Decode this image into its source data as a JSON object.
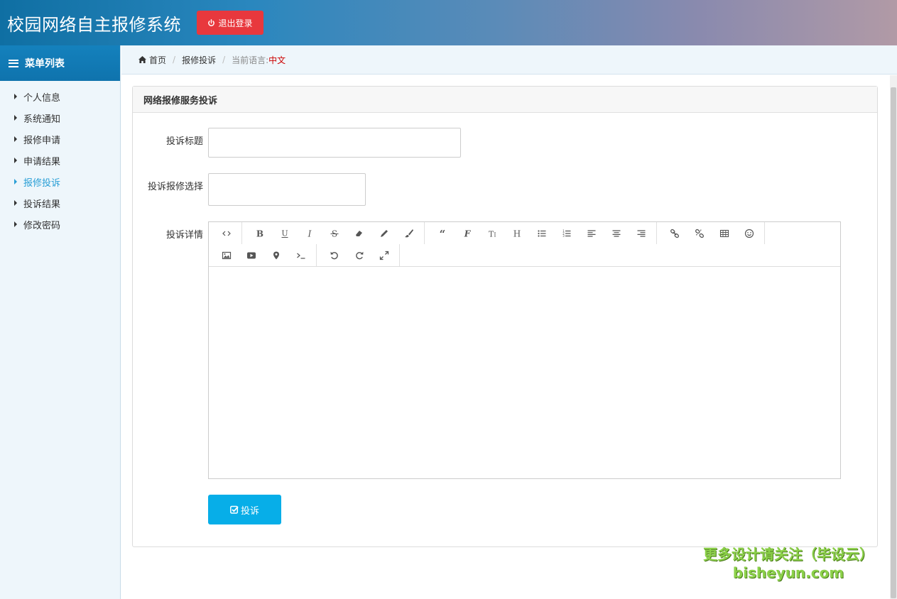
{
  "header": {
    "title": "校园网络自主报修系统",
    "logout_label": "退出登录",
    "logout_color": "#e8383d"
  },
  "sidebar": {
    "heading": "菜单列表",
    "items": [
      {
        "label": "个人信息",
        "active": false
      },
      {
        "label": "系统通知",
        "active": false
      },
      {
        "label": "报修申请",
        "active": false
      },
      {
        "label": "申请结果",
        "active": false
      },
      {
        "label": "报修投诉",
        "active": true
      },
      {
        "label": "投诉结果",
        "active": false
      },
      {
        "label": "修改密码",
        "active": false
      }
    ]
  },
  "breadcrumb": {
    "home": "首页",
    "current": "报修投诉",
    "lang_label": "当前语言:",
    "lang_value": "中文"
  },
  "panel": {
    "title": "网络报修服务投诉"
  },
  "form": {
    "title_label": "投诉标题",
    "title_value": "",
    "select_label": "投诉报修选择",
    "select_value": "",
    "detail_label": "投诉详情",
    "detail_value": "",
    "submit_label": "投诉"
  },
  "editor_toolbar": {
    "row1": [
      [
        "code-view-icon"
      ],
      [
        "bold-icon",
        "underline-icon",
        "italic-icon",
        "strikethrough-icon",
        "eraser-icon",
        "pencil-icon",
        "brush-icon"
      ],
      [
        "blockquote-icon",
        "font-icon",
        "font-size-icon",
        "heading-icon",
        "unordered-list-icon",
        "ordered-list-icon",
        "align-left-icon",
        "align-center-icon",
        "align-right-icon"
      ],
      [
        "link-icon",
        "unlink-icon",
        "table-icon",
        "emoji-icon"
      ]
    ],
    "row2": [
      [
        "image-icon",
        "video-icon",
        "location-icon",
        "code-block-icon"
      ],
      [
        "undo-icon",
        "redo-icon",
        "fullscreen-icon"
      ]
    ]
  },
  "watermark": {
    "line1": "更多设计请关注（毕设云）",
    "line2": "bisheyun.com"
  },
  "colors": {
    "accent": "#07aee8",
    "active_menu": "#2a9fd6",
    "lang_value": "#cc0000",
    "watermark": "#8cd14a"
  }
}
